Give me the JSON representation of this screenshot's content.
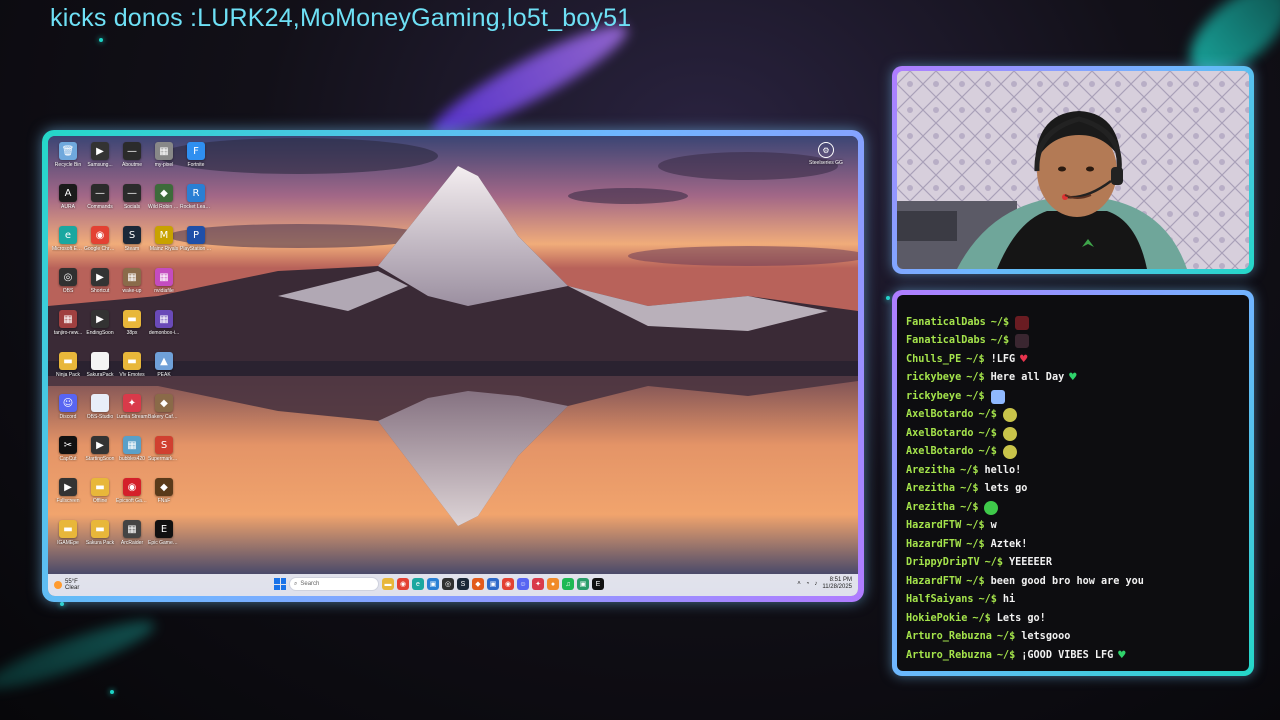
{
  "banner": {
    "text": "kicks donos :LURK24,MoMoneyGaming,lo5t_boy51"
  },
  "desktop": {
    "icons": [
      {
        "label": "Recycle Bin",
        "icon": "recycle-bin-icon",
        "color": "#6fa8dc",
        "glyph": "🗑"
      },
      {
        "label": "Samsung...",
        "icon": "app-icon",
        "color": "#333333",
        "glyph": "▶"
      },
      {
        "label": "Aboutme",
        "icon": "file-icon",
        "color": "#2b2b2b",
        "glyph": "—"
      },
      {
        "label": "my-pixel",
        "icon": "image-icon",
        "color": "#888888",
        "glyph": "▦"
      },
      {
        "label": "Fortnite",
        "icon": "fortnite-icon",
        "color": "#2f8ff0",
        "glyph": "F"
      },
      {
        "label": "AURA",
        "icon": "aura-icon",
        "color": "#1a1a1a",
        "glyph": "A"
      },
      {
        "label": "Commands",
        "icon": "file-icon",
        "color": "#2b2b2b",
        "glyph": "—"
      },
      {
        "label": "Socials",
        "icon": "file-icon",
        "color": "#2b2b2b",
        "glyph": "—"
      },
      {
        "label": "Wild Robin Chill Y...",
        "icon": "game-icon",
        "color": "#3d6b3a",
        "glyph": "◆"
      },
      {
        "label": "Rocket League",
        "icon": "rocket-league-icon",
        "color": "#2a7fd4",
        "glyph": "R"
      },
      {
        "label": "Microsoft Edge",
        "icon": "edge-icon",
        "color": "#1aa7a0",
        "glyph": "e"
      },
      {
        "label": "Google Chrome",
        "icon": "chrome-icon",
        "color": "#e34133",
        "glyph": "◉"
      },
      {
        "label": "Steam",
        "icon": "steam-icon",
        "color": "#1b2838",
        "glyph": "S"
      },
      {
        "label": "Mainz Riyals",
        "icon": "game-icon",
        "color": "#c8a200",
        "glyph": "M"
      },
      {
        "label": "PlayStation Accessories",
        "icon": "playstation-icon",
        "color": "#1f4fa8",
        "glyph": "P"
      },
      {
        "label": "OBS",
        "icon": "obs-icon",
        "color": "#303030",
        "glyph": "◎"
      },
      {
        "label": "Shortcut",
        "icon": "app-icon",
        "color": "#333333",
        "glyph": "▶"
      },
      {
        "label": "wake-up",
        "icon": "image-icon",
        "color": "#8a6b4a",
        "glyph": "▦"
      },
      {
        "label": "nvidiafile",
        "icon": "image-icon",
        "color": "#c44cc0",
        "glyph": "▦"
      },
      {
        "label": "",
        "icon": "blank-icon",
        "color": "transparent",
        "glyph": ""
      },
      {
        "label": "tanjiro-new...",
        "icon": "image-icon",
        "color": "#a04040",
        "glyph": "▦"
      },
      {
        "label": "EndingSoon",
        "icon": "app-icon",
        "color": "#333333",
        "glyph": "▶"
      },
      {
        "label": "38px",
        "icon": "folder-icon",
        "color": "#e8b73a",
        "glyph": "▬"
      },
      {
        "label": "demonbox-i...",
        "icon": "image-icon",
        "color": "#6a4ab8",
        "glyph": "▦"
      },
      {
        "label": "",
        "icon": "blank-icon",
        "color": "transparent",
        "glyph": ""
      },
      {
        "label": "Ninja Pack",
        "icon": "folder-icon",
        "color": "#e8b73a",
        "glyph": "▬"
      },
      {
        "label": "SakuraPack",
        "icon": "file-icon",
        "color": "#f4f4f4",
        "glyph": ""
      },
      {
        "label": "Vlv Emotes",
        "icon": "folder-icon",
        "color": "#e8b73a",
        "glyph": "▬"
      },
      {
        "label": "PEAK",
        "icon": "image-icon",
        "color": "#6fa0d8",
        "glyph": "▲"
      },
      {
        "label": "",
        "icon": "blank-icon",
        "color": "transparent",
        "glyph": ""
      },
      {
        "label": "Discord",
        "icon": "discord-icon",
        "color": "#5865f2",
        "glyph": "☺"
      },
      {
        "label": "OBS-Studio",
        "icon": "file-icon",
        "color": "#e8eef8",
        "glyph": ""
      },
      {
        "label": "Lumia Stream",
        "icon": "lumia-icon",
        "color": "#d93a4a",
        "glyph": "✦"
      },
      {
        "label": "Bakery Cafe Simulator",
        "icon": "game-icon",
        "color": "#8a6a48",
        "glyph": "◆"
      },
      {
        "label": "",
        "icon": "blank-icon",
        "color": "transparent",
        "glyph": ""
      },
      {
        "label": "CapCut",
        "icon": "capcut-icon",
        "color": "#111111",
        "glyph": "✂"
      },
      {
        "label": "StartingSoon",
        "icon": "app-icon",
        "color": "#333333",
        "glyph": "▶"
      },
      {
        "label": "bubbles420",
        "icon": "image-icon",
        "color": "#5aa0c8",
        "glyph": "▦"
      },
      {
        "label": "Supermarket Together",
        "icon": "game-icon",
        "color": "#d04030",
        "glyph": "S"
      },
      {
        "label": "",
        "icon": "blank-icon",
        "color": "transparent",
        "glyph": ""
      },
      {
        "label": "Fullscreen",
        "icon": "app-icon",
        "color": "#333333",
        "glyph": "▶"
      },
      {
        "label": "Offline",
        "icon": "folder-icon",
        "color": "#e8b73a",
        "glyph": "▬"
      },
      {
        "label": "Epicsoft Gaming",
        "icon": "app-icon",
        "color": "#d4202a",
        "glyph": "◉"
      },
      {
        "label": "FNaF",
        "icon": "game-icon",
        "color": "#5a3a1a",
        "glyph": "◆"
      },
      {
        "label": "",
        "icon": "blank-icon",
        "color": "transparent",
        "glyph": ""
      },
      {
        "label": "IGAMEpe",
        "icon": "folder-icon",
        "color": "#e8b73a",
        "glyph": "▬"
      },
      {
        "label": "Sakura Pack",
        "icon": "folder-icon",
        "color": "#e8b73a",
        "glyph": "▬"
      },
      {
        "label": "ArcRaider",
        "icon": "image-icon",
        "color": "#444444",
        "glyph": "▦"
      },
      {
        "label": "Epic Games Launcher",
        "icon": "epic-games-icon",
        "color": "#111111",
        "glyph": "E"
      },
      {
        "label": "",
        "icon": "blank-icon",
        "color": "transparent",
        "glyph": ""
      }
    ],
    "corner_icon": {
      "label": "Steelseries GG",
      "icon": "steelseries-icon",
      "glyph": "⚙"
    },
    "taskbar": {
      "weather_temp": "55°F",
      "weather_desc": "Clear",
      "search_placeholder": "Search",
      "apps": [
        {
          "icon": "file-explorer-icon",
          "color": "#e8b73a",
          "glyph": "▬"
        },
        {
          "icon": "chrome-icon",
          "color": "#e34133",
          "glyph": "◉"
        },
        {
          "icon": "edge-icon",
          "color": "#1aa7a0",
          "glyph": "e"
        },
        {
          "icon": "store-icon",
          "color": "#2a7fd4",
          "glyph": "▣"
        },
        {
          "icon": "obs-icon",
          "color": "#303030",
          "glyph": "◎"
        },
        {
          "icon": "steam-icon",
          "color": "#1b2838",
          "glyph": "S"
        },
        {
          "icon": "game-icon",
          "color": "#e25a1c",
          "glyph": "◆"
        },
        {
          "icon": "app-icon",
          "color": "#2d69c8",
          "glyph": "▣"
        },
        {
          "icon": "chrome-icon",
          "color": "#e34133",
          "glyph": "◉"
        },
        {
          "icon": "discord-icon",
          "color": "#5865f2",
          "glyph": "☺"
        },
        {
          "icon": "lumia-icon",
          "color": "#d93a4a",
          "glyph": "✦"
        },
        {
          "icon": "app-icon",
          "color": "#f08a2a",
          "glyph": "●"
        },
        {
          "icon": "spotify-icon",
          "color": "#1db954",
          "glyph": "♫"
        },
        {
          "icon": "app-icon",
          "color": "#2a9d6a",
          "glyph": "▣"
        },
        {
          "icon": "epic-games-icon",
          "color": "#111111",
          "glyph": "E"
        }
      ],
      "time": "8:51 PM",
      "date": "11/28/2025"
    }
  },
  "chat": {
    "prompt": "~/$",
    "messages": [
      {
        "user": "FanaticalDabs",
        "text": "",
        "emote": "emote-fanaticaldabs-1"
      },
      {
        "user": "FanaticalDabs",
        "text": "",
        "emote": "emote-fanaticaldabs-2"
      },
      {
        "user": "Chulls_PE",
        "text": "!LFG",
        "emote": "red-heart"
      },
      {
        "user": "rickybeye",
        "text": "Here all Day",
        "emote": "green-heart"
      },
      {
        "user": "rickybeye",
        "text": "",
        "emote": "emote-rickybeye"
      },
      {
        "user": "AxelBotardo",
        "text": "",
        "emote": "emote-axel"
      },
      {
        "user": "AxelBotardo",
        "text": "",
        "emote": "emote-axel"
      },
      {
        "user": "AxelBotardo",
        "text": "",
        "emote": "emote-axel"
      },
      {
        "user": "Arezitha",
        "text": "hello!",
        "emote": ""
      },
      {
        "user": "Arezitha",
        "text": "lets go",
        "emote": ""
      },
      {
        "user": "Arezitha",
        "text": "",
        "emote": "emote-green"
      },
      {
        "user": "HazardFTW",
        "text": "w",
        "emote": ""
      },
      {
        "user": "HazardFTW",
        "text": "Aztek!",
        "emote": ""
      },
      {
        "user": "DrippyDripTV",
        "text": "YEEEEER",
        "emote": ""
      },
      {
        "user": "HazardFTW",
        "text": "been good bro how are you",
        "emote": ""
      },
      {
        "user": "HalfSaiyans",
        "text": "hi",
        "emote": ""
      },
      {
        "user": "HokiePokie",
        "text": "Lets go!",
        "emote": ""
      },
      {
        "user": "Arturo_Rebuzna",
        "text": "letsgooo",
        "emote": ""
      },
      {
        "user": "Arturo_Rebuzna",
        "text": "¡GOOD VIBES LFG",
        "emote": "green-heart"
      }
    ]
  }
}
